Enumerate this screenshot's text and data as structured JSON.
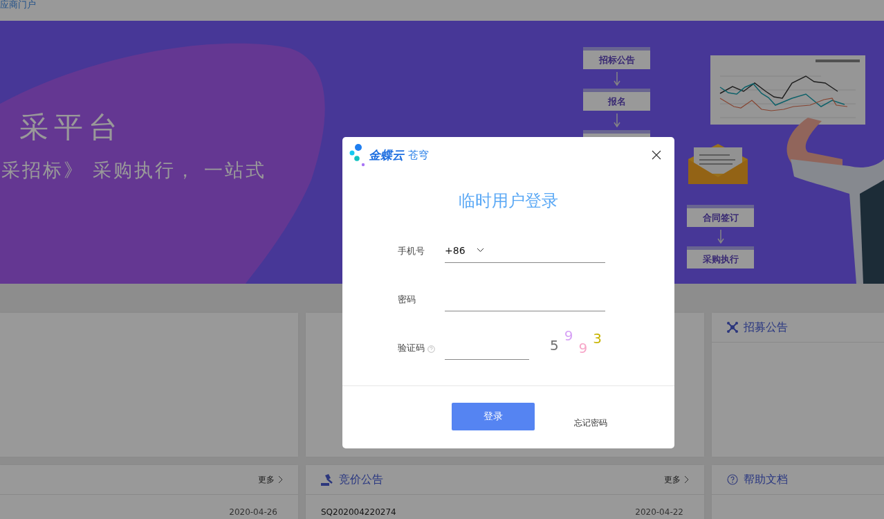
{
  "top_bar": {
    "portal_link": "应商门户"
  },
  "banner": {
    "title": "采平台",
    "subtitle": "采招标》 采购执行， 一站式",
    "flow_left": [
      {
        "label": "招标公告"
      },
      {
        "label": "报名"
      }
    ],
    "flow_right": [
      {
        "label": "合同签订"
      },
      {
        "label": "采购执行"
      }
    ]
  },
  "panels": [
    {
      "kind": "blank"
    },
    {
      "kind": "blank"
    },
    {
      "kind": "recruit",
      "title": "招募公告"
    },
    {
      "kind": "list",
      "more": "更多",
      "rows": [
        {
          "date": "2020-04-26"
        }
      ]
    },
    {
      "kind": "auction",
      "title": "竞价公告",
      "more": "更多",
      "rows": [
        {
          "code": "SQ202004220274",
          "date": "2020-04-22"
        }
      ]
    },
    {
      "kind": "help",
      "title": "帮助文档"
    }
  ],
  "dialog": {
    "logo_brand": "金蝶云",
    "logo_product": "苍穹",
    "title": "临时用户登录",
    "fields": [
      {
        "kind": "phone",
        "label": "手机号",
        "country_code": "+86"
      },
      {
        "kind": "password",
        "label": "密码"
      },
      {
        "kind": "captcha",
        "label": "验证码",
        "captcha": [
          {
            "char": "5",
            "color": "#707070"
          },
          {
            "char": "9",
            "color": "#d7a2f5"
          },
          {
            "char": "9",
            "color": "#f7a6c8"
          },
          {
            "char": "3",
            "color": "#c8b400"
          }
        ]
      }
    ],
    "login_button": "登录",
    "forgot_link": "忘记密码"
  }
}
